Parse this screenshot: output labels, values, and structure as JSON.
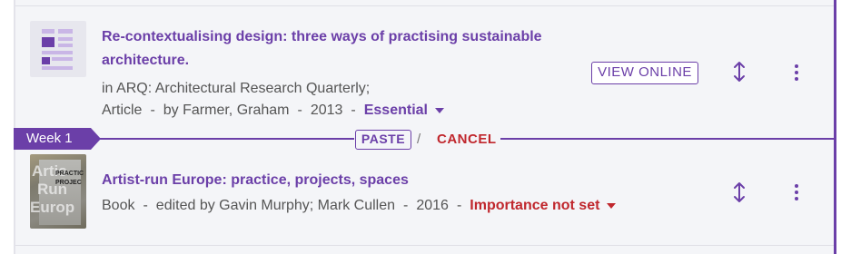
{
  "items": [
    {
      "title_line1": "Re-contextualising design: three ways of practising sustainable",
      "title_line2": "architecture.",
      "meta_line1": "in ARQ: Architectural Research Quarterly;",
      "type": "Article",
      "sep": "-",
      "author": "by Farmer, Graham",
      "year": "2013",
      "importance": "Essential",
      "view_online_label": "VIEW ONLINE"
    },
    {
      "title": "Artist-run Europe: practice, projects, spaces",
      "type": "Book",
      "sep": "-",
      "author": "edited by Gavin Murphy; Mark Cullen",
      "year": "2016",
      "importance": "Importance not set",
      "thumb_text_line1": "Artis",
      "thumb_text_line2": "Run",
      "thumb_text_line3": "Europ",
      "thumb_small_line1": "PRACTIC",
      "thumb_small_line2": "PROJEC"
    }
  ],
  "paste_bar": {
    "week_label": "Week 1",
    "paste_label": "PASTE",
    "slash": "/",
    "cancel_label": "CANCEL"
  },
  "icons": {
    "move": "move-vertical-icon",
    "more": "more-vertical-icon",
    "document": "document-icon"
  },
  "colors": {
    "accent": "#6b3fa8",
    "danger": "#c0272d",
    "background": "#f4f5f8"
  }
}
